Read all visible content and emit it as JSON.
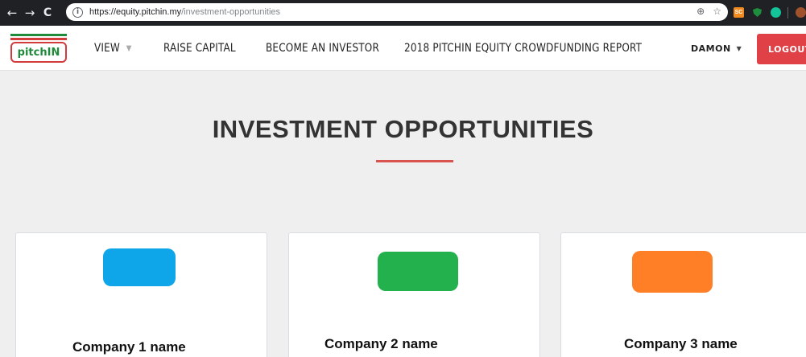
{
  "browser": {
    "back_label": "←",
    "forward_label": "→",
    "reload_label": "C",
    "info_label": "i",
    "url_host": "https://equity.pitchin.my",
    "url_path": "/investment-opportunities",
    "zoom_icon": "⊕",
    "star_icon": "☆",
    "extensions": [
      {
        "name": "sc-extension-icon",
        "label": "SC",
        "color": "#f28b1f"
      },
      {
        "name": "shield-extension-icon",
        "color": "#1e8e3e"
      },
      {
        "name": "grammarly-icon",
        "color": "#15c39a"
      }
    ]
  },
  "header": {
    "logo_text": "pitchIN",
    "nav": [
      {
        "label": "VIEW",
        "has_dropdown": true
      },
      {
        "label": "RAISE CAPITAL"
      },
      {
        "label": "BECOME AN INVESTOR"
      },
      {
        "label": "2018 PITCHIN EQUITY CROWDFUNDING REPORT"
      }
    ],
    "user_label": "DAMON",
    "logout_label": "LOGOUT"
  },
  "main": {
    "title": "INVESTMENT OPPORTUNITIES",
    "accent_color": "#d9534f",
    "cards": [
      {
        "name": "Company 1 name",
        "swatch_color": "#0ea5e9"
      },
      {
        "name": "Company 2 name",
        "swatch_color": "#22b14c"
      },
      {
        "name": "Company 3 name",
        "swatch_color": "#ff7f27"
      }
    ]
  }
}
